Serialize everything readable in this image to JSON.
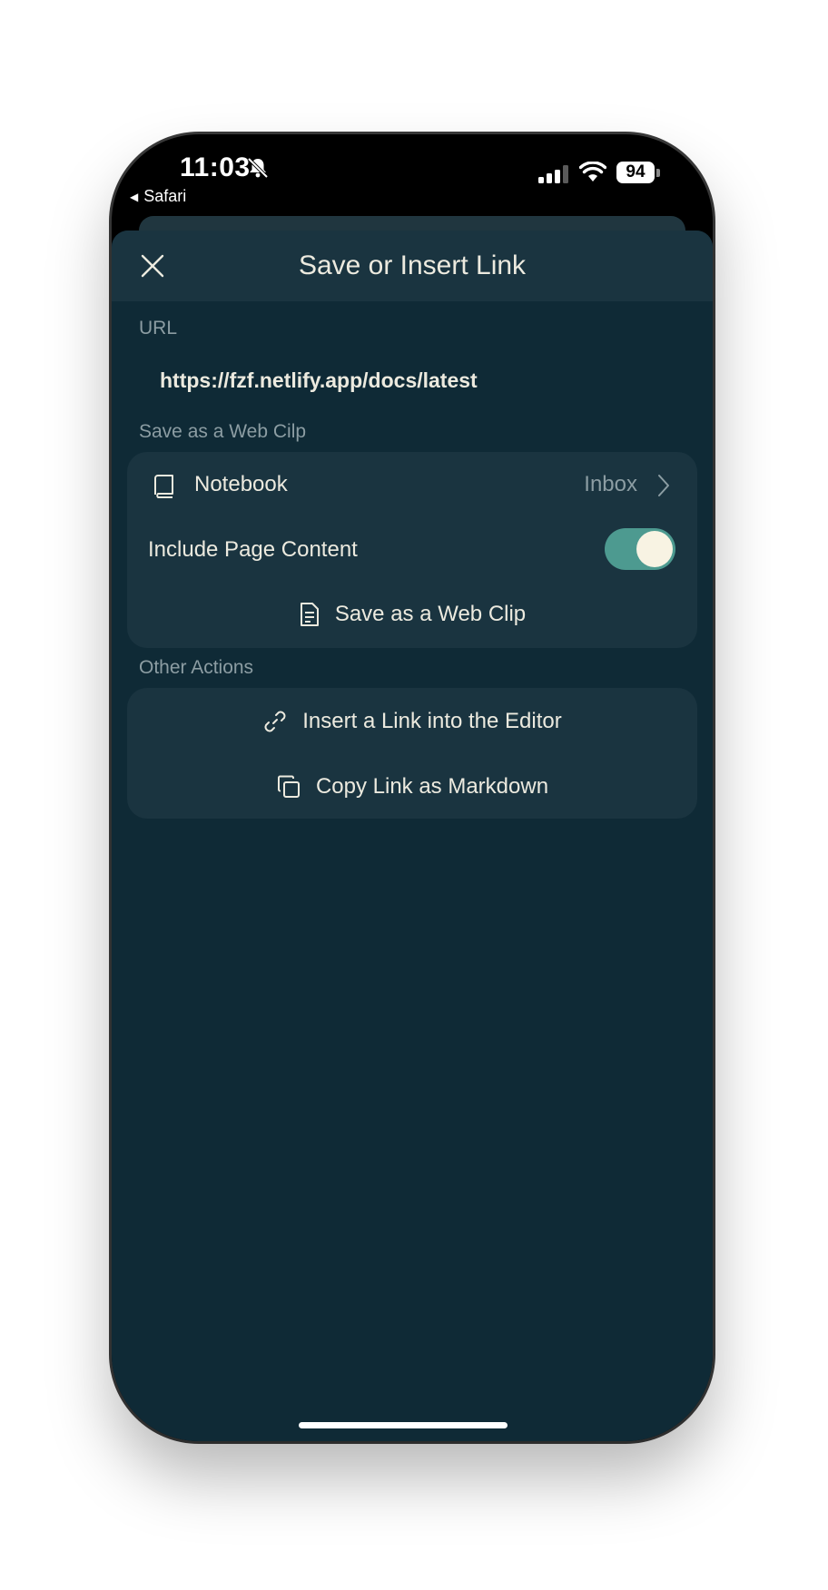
{
  "status_bar": {
    "time": "11:03",
    "back_app": "Safari",
    "battery": "94",
    "icons": [
      "bell-slash-icon",
      "cellular-signal-icon",
      "wifi-icon",
      "battery-icon"
    ]
  },
  "sheet": {
    "title": "Save or Insert Link",
    "close_icon": "close-icon"
  },
  "url_section": {
    "label": "URL",
    "value": "https://fzf.netlify.app/docs/latest"
  },
  "web_clip_section": {
    "label": "Save as a Web Cilp",
    "notebook_label": "Notebook",
    "notebook_value": "Inbox",
    "notebook_icon": "book-icon",
    "include_label": "Include Page Content",
    "include_enabled": true,
    "save_label": "Save as a Web Clip",
    "save_icon": "document-icon"
  },
  "other_actions_section": {
    "label": "Other Actions",
    "insert_label": "Insert a Link into the Editor",
    "insert_icon": "link-icon",
    "copy_label": "Copy Link as Markdown",
    "copy_icon": "copy-icon"
  },
  "colors": {
    "sheet_background": "#0f2a36",
    "card_background": "#1a3440",
    "text_primary": "#eceadf",
    "text_secondary": "#8c9da3",
    "toggle_on": "#4d9a90"
  }
}
